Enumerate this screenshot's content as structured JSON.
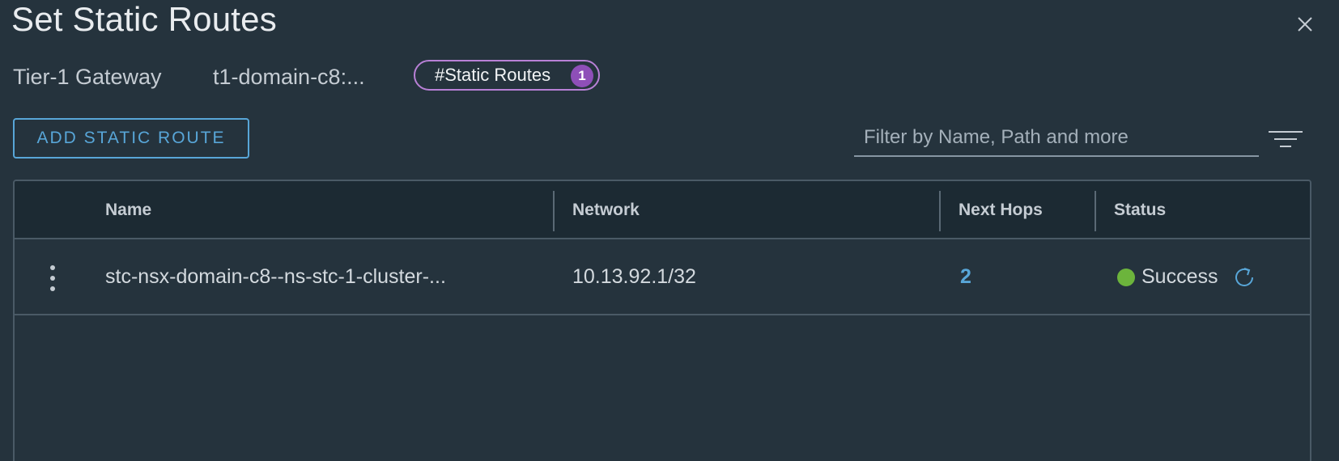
{
  "dialog": {
    "title": "Set Static Routes"
  },
  "meta": {
    "gateway_label": "Tier-1 Gateway",
    "gateway_value": "t1-domain-c8:...",
    "pill_label": "#Static Routes",
    "pill_count": "1"
  },
  "toolbar": {
    "add_label": "ADD STATIC ROUTE",
    "filter_placeholder": "Filter by Name, Path and more"
  },
  "table": {
    "columns": [
      "Name",
      "Network",
      "Next Hops",
      "Status"
    ],
    "rows": [
      {
        "name": "stc-nsx-domain-c8--ns-stc-1-cluster-...",
        "network": "10.13.92.1/32",
        "next_hops": "2",
        "status": "Success"
      }
    ]
  },
  "colors": {
    "background": "#25333d",
    "accent": "#58a6d8",
    "pill_border": "#b880d6",
    "badge": "#8e4fb8",
    "success": "#6cb43c"
  },
  "icons": [
    "close-icon",
    "filter-icon",
    "kebab-menu-icon",
    "status-success-icon",
    "refresh-icon"
  ]
}
